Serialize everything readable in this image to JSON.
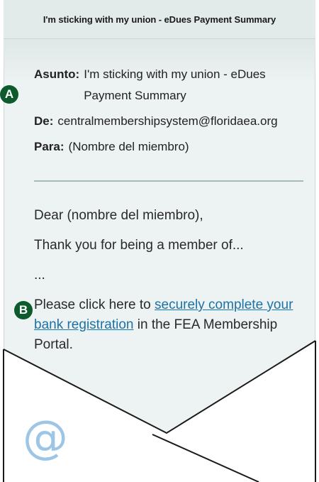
{
  "email": {
    "subject_header": "I'm sticking with my union - eDues Payment Summary",
    "fields": {
      "asunto_label": "Asunto:",
      "asunto_value": "I'm sticking with my union - eDues Payment Summary",
      "de_label": "De:",
      "de_value": "centralmembershipsystem@floridaea.org",
      "para_label": "Para:",
      "para_value": "(Nombre del miembro)"
    },
    "body": {
      "greeting": "Dear (nombre del miembro),",
      "line1": "Thank you for being a member of...",
      "ellipsis": "...",
      "cta_prefix": "Please click here to ",
      "cta_link": "securely complete your bank registration",
      "cta_suffix": " in the FEA Membership Portal."
    }
  },
  "callouts": {
    "a": "A",
    "b": "B"
  },
  "icons": {
    "envelope": "envelope-icon",
    "at": "@"
  },
  "colors": {
    "paper": "#edf2f2",
    "badge": "#0d5a2c",
    "link": "#1a73a8",
    "at_icon": "#9cc5e6"
  }
}
